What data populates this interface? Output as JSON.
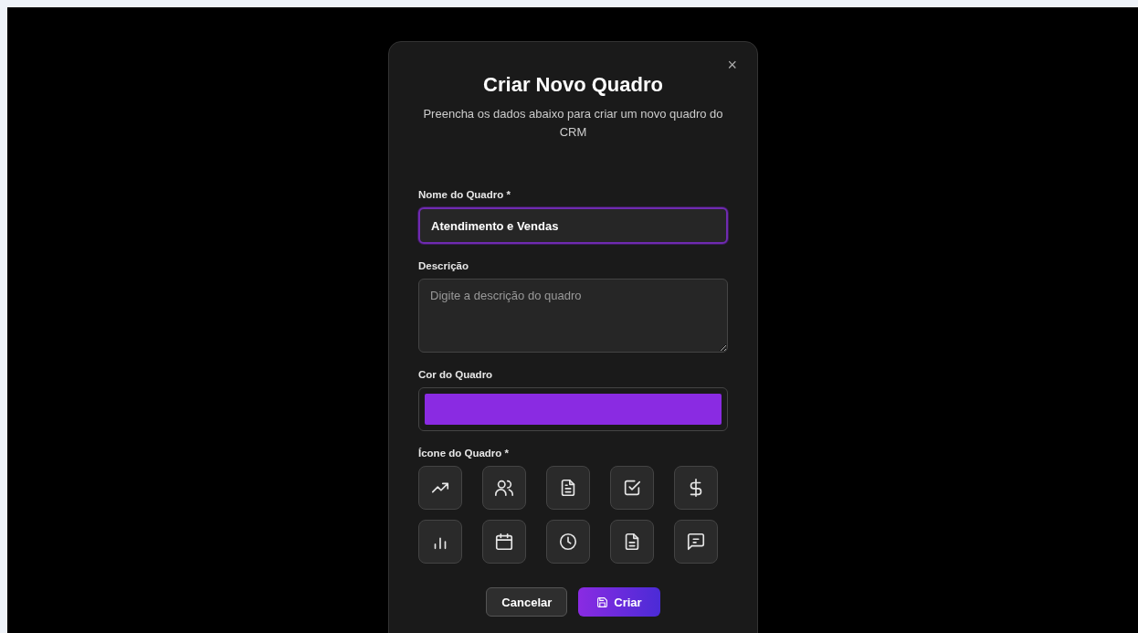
{
  "dialog": {
    "title": "Criar Novo Quadro",
    "subtitle": "Preencha os dados abaixo para criar um novo quadro do CRM",
    "close": "×",
    "name_field": {
      "label": "Nome do Quadro *",
      "value": "Atendimento e Vendas",
      "focused": true
    },
    "description_field": {
      "label": "Descrição",
      "placeholder": "Digite a descrição do quadro"
    },
    "color_field": {
      "label": "Cor do Quadro",
      "color": "#8a2be2"
    },
    "icon_picker": {
      "label": "Ícone do Quadro *",
      "options": [
        {
          "kind": "trend",
          "selected": false
        },
        {
          "kind": "users",
          "selected": false
        },
        {
          "kind": "file",
          "selected": false
        },
        {
          "kind": "check",
          "selected": false
        },
        {
          "kind": "dollar",
          "selected": false
        },
        {
          "kind": "bars",
          "selected": false
        },
        {
          "kind": "calendar",
          "selected": false
        },
        {
          "kind": "clock",
          "selected": false
        },
        {
          "kind": "doc",
          "selected": false
        },
        {
          "kind": "message",
          "selected": false
        }
      ]
    },
    "buttons": [
      {
        "kind": "secondary",
        "label": "Cancelar"
      },
      {
        "kind": "primary",
        "label": "Criar"
      }
    ]
  }
}
